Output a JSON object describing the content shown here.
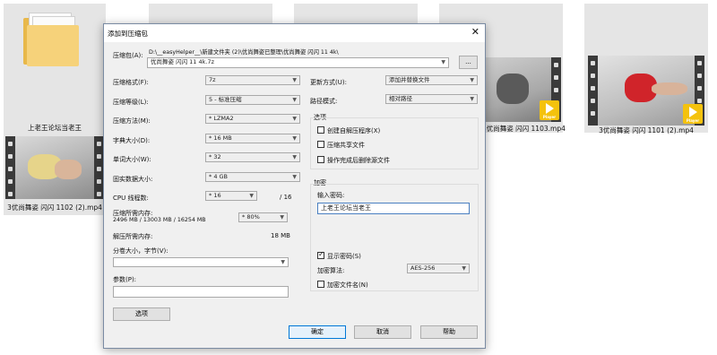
{
  "files": [
    {
      "caption": "上老王论坛当老王",
      "type": "folder"
    },
    {
      "caption": "3优尚舞姿 闪闪 1102 (2).mp4",
      "type": "video"
    },
    {
      "caption": "3优尚舞姿 闪闪 1103.mp4",
      "type": "video"
    },
    {
      "caption": "3优尚舞姿 闪闪 1101 (2).mp4",
      "type": "video"
    }
  ],
  "player_badge": "Player",
  "dialog": {
    "title": "添加到压缩包",
    "close_glyph": "✕",
    "archive_label": "压缩包(A):",
    "archive_path": "D:\\__easyHelper__\\新建文件夹 (2)\\优尚舞姿已整理\\优尚舞姿 闪闪 11 4k\\",
    "archive_name": "优尚舞姿 闪闪 11 4k.7z",
    "browse_label": "...",
    "format_label": "压缩格式(F):",
    "format_value": "7z",
    "level_label": "压缩等级(L):",
    "level_value": "5 - 标准压缩",
    "method_label": "压缩方法(M):",
    "method_value": "* LZMA2",
    "dict_label": "字典大小(D):",
    "dict_value": "* 16 MB",
    "word_label": "单词大小(W):",
    "word_value": "* 32",
    "solid_label": "固实数据大小:",
    "solid_value": "* 4 GB",
    "cpu_label": "CPU 线程数:",
    "cpu_value": "* 16",
    "cpu_total": "/ 16",
    "mem_comp_label": "压缩所需内存:",
    "mem_comp_detail": "2496 MB / 13003 MB / 16254 MB",
    "mem_comp_value": "* 80%",
    "mem_decomp_label": "解压所需内存:",
    "mem_decomp_value": "18 MB",
    "split_label": "分卷大小，字节(V):",
    "split_value": "",
    "params_label": "参数(P):",
    "params_value": "",
    "options_button": "选项",
    "update_label": "更新方式(U):",
    "update_value": "添加并替换文件",
    "pathmode_label": "路径模式:",
    "pathmode_value": "相对路径",
    "options_group": "选项",
    "opt_sfx": "创建自解压程序(X)",
    "opt_shared": "压缩共享文件",
    "opt_delete": "操作完成后删除源文件",
    "encrypt_group": "加密",
    "password_label": "输入密码:",
    "password_value": "上老王论坛当老王",
    "show_password": "显示密码(S)",
    "show_password_checked": true,
    "enc_method_label": "加密算法:",
    "enc_method_value": "AES-256",
    "encrypt_names": "加密文件名(N)",
    "ok": "确定",
    "cancel": "取消",
    "help": "帮助"
  },
  "icons": {
    "dropdown": "chevron-down-icon",
    "check": "✓"
  },
  "colors": {
    "player_badge": "#f4c20d",
    "dialog_bg": "#f0f0f0",
    "focus_border": "#0078d7"
  }
}
